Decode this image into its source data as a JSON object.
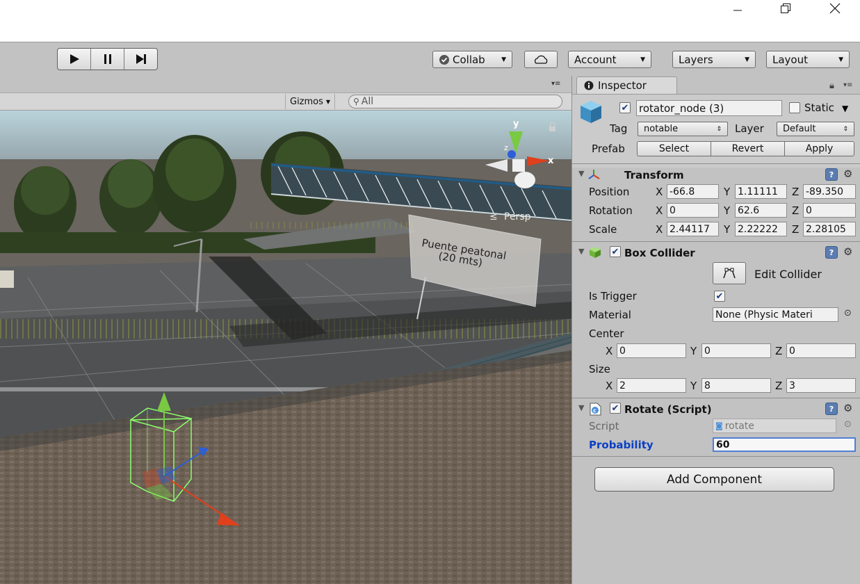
{
  "toolbar": {
    "play_icon": "play-icon",
    "pause_icon": "pause-icon",
    "step_icon": "step-icon",
    "collab_label": "Collab",
    "account_label": "Account",
    "layers_label": "Layers",
    "layout_label": "Layout"
  },
  "scene": {
    "gizmos_label": "Gizmos",
    "search_placeholder": "All",
    "persp_label": "Persp",
    "axis_y": "y",
    "axis_x": "x",
    "axis_z": "z",
    "sign_line1": "Puente peatonal",
    "sign_line2": "(20 mts)"
  },
  "inspector": {
    "tab_label": "Inspector",
    "object_name": "rotator_node (3)",
    "static_label": "Static",
    "tag_label": "Tag",
    "tag_value": "notable",
    "layer_label": "Layer",
    "layer_value": "Default",
    "prefab_label": "Prefab",
    "prefab_select": "Select",
    "prefab_revert": "Revert",
    "prefab_apply": "Apply",
    "transform": {
      "title": "Transform",
      "position_label": "Position",
      "rotation_label": "Rotation",
      "scale_label": "Scale",
      "x": "X",
      "y": "Y",
      "z": "Z",
      "position": [
        "-66.8",
        "1.11111",
        "-89.350"
      ],
      "rotation": [
        "0",
        "62.6",
        "0"
      ],
      "scale": [
        "2.44117",
        "2.22222",
        "2.28105"
      ]
    },
    "box_collider": {
      "title": "Box Collider",
      "edit_collider": "Edit Collider",
      "is_trigger_label": "Is Trigger",
      "material_label": "Material",
      "material_value": "None (Physic Materi",
      "center_label": "Center",
      "center": [
        "0",
        "0",
        "0"
      ],
      "size_label": "Size",
      "size": [
        "2",
        "8",
        "3"
      ]
    },
    "rotate_script": {
      "title": "Rotate (Script)",
      "script_label": "Script",
      "script_value": "rotate",
      "probability_label": "Probability",
      "probability_value": "60"
    },
    "add_component": "Add Component"
  },
  "colors": {
    "editor_grey": "#c2c2c2",
    "probability_label": "#0b3fc4",
    "selection_green": "#8dff6e",
    "gizmo_red": "#e0401c",
    "gizmo_green": "#7ac943",
    "gizmo_blue": "#2d5fd6"
  }
}
